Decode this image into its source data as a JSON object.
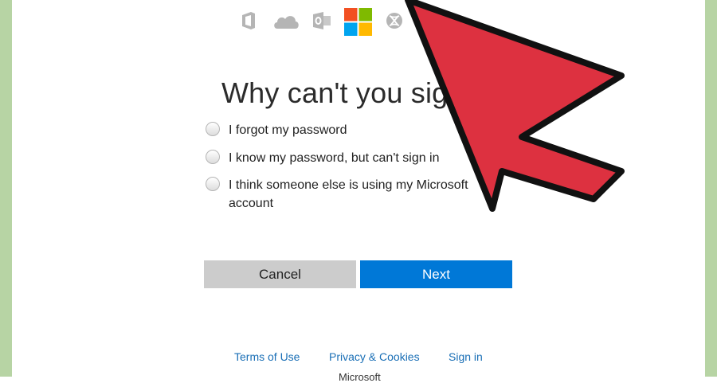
{
  "header": {
    "icons": [
      "office-icon",
      "onedrive-icon",
      "outlook-icon",
      "microsoft-logo-icon",
      "xbox-icon"
    ],
    "brand_colors": {
      "red": "#f25022",
      "green": "#7fba00",
      "blue": "#00a4ef",
      "yellow": "#ffb900"
    }
  },
  "main": {
    "title": "Why can't you sig",
    "options": [
      {
        "label": "I forgot my password",
        "selected": false
      },
      {
        "label": "I know my password, but can't sign in",
        "selected": false
      },
      {
        "label": "I think someone else is using my Microsoft account",
        "selected": false
      }
    ],
    "cancel_label": "Cancel",
    "next_label": "Next",
    "accent_color": "#0078d7"
  },
  "footer": {
    "terms": "Terms of Use",
    "privacy": "Privacy & Cookies",
    "signin": "Sign in",
    "brand": "Microsoft"
  },
  "annotation": {
    "arrow_color": "#dd3140"
  }
}
